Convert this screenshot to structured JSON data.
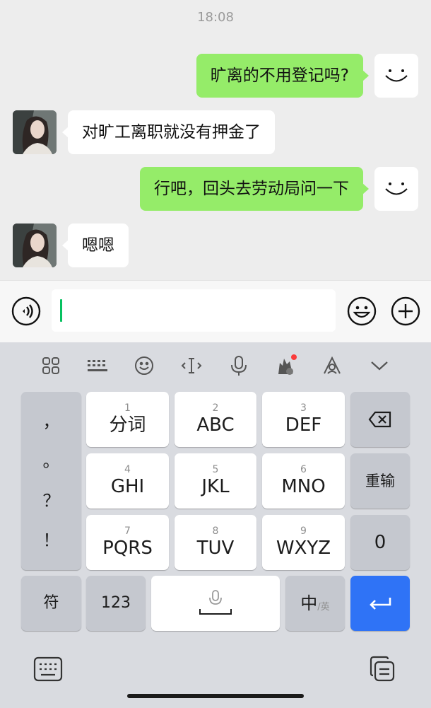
{
  "chat": {
    "time": "18:08",
    "messages": [
      {
        "from": "me",
        "text": "旷离的不用登记吗?"
      },
      {
        "from": "her",
        "text": "对旷工离职就没有押金了"
      },
      {
        "from": "me",
        "text": "行吧，回头去劳动局问一下"
      },
      {
        "from": "her",
        "text": "嗯嗯"
      }
    ]
  },
  "input": {
    "value": ""
  },
  "keyboard": {
    "punct_keys": [
      "，",
      "。",
      "？",
      "！"
    ],
    "keys": [
      {
        "num": "1",
        "label": "分词"
      },
      {
        "num": "2",
        "label": "ABC"
      },
      {
        "num": "3",
        "label": "DEF"
      },
      {
        "num": "4",
        "label": "GHI"
      },
      {
        "num": "5",
        "label": "JKL"
      },
      {
        "num": "6",
        "label": "MNO"
      },
      {
        "num": "7",
        "label": "PQRS"
      },
      {
        "num": "8",
        "label": "TUV"
      },
      {
        "num": "9",
        "label": "WXYZ"
      }
    ],
    "reinput_label": "重输",
    "zero_label": "0",
    "symbol_label": "符",
    "numeric_label": "123",
    "lang_main": "中",
    "lang_sub": "/英"
  },
  "colors": {
    "accent_green": "#95ec69",
    "enter_blue": "#2f73f6",
    "cursor": "#07c160",
    "badge_red": "#fa3b3b"
  },
  "icons": [
    "voice-icon",
    "emoji-icon",
    "plus-icon",
    "grid-icon",
    "keyboard-icon",
    "smile-icon",
    "cursor-move-icon",
    "mic-icon",
    "theme-icon",
    "skin-icon",
    "collapse-icon",
    "backspace-icon",
    "enter-icon",
    "switch-keyboard-icon",
    "clipboard-icon"
  ]
}
